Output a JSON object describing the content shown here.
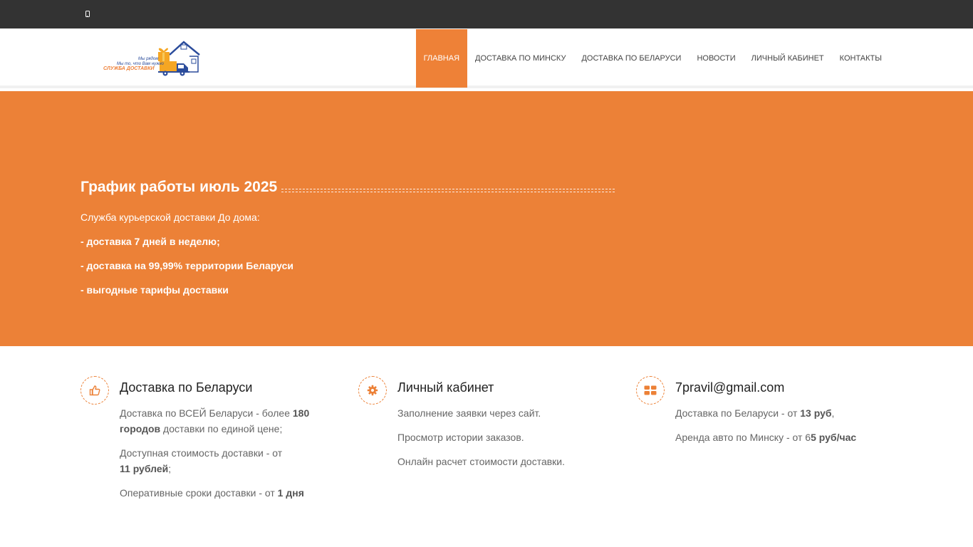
{
  "header": {
    "logo": {
      "tagline_1": "Мы рядом",
      "tagline_2": "Мы то, что Вам нужно",
      "name": "СЛУЖБА ДОСТАВКИ"
    },
    "nav": [
      {
        "label": "Главная",
        "active": true
      },
      {
        "label": "Доставка по Минску",
        "active": false
      },
      {
        "label": "Доставка по Беларуси",
        "active": false
      },
      {
        "label": "Новости",
        "active": false
      },
      {
        "label": "Личный кабинет",
        "active": false
      },
      {
        "label": "Контакты",
        "active": false
      }
    ]
  },
  "hero": {
    "title": "График работы июль 2025",
    "intro": "Служба курьерской доставки До дома:",
    "points": [
      "- доставка 7 дней в неделю;",
      "- доставка на 99,99% территории Беларуси",
      "- выгодные тарифы доставки"
    ]
  },
  "features": [
    {
      "icon": "thumbs-up-icon",
      "title": "Доставка по Беларуси",
      "paras": [
        {
          "pre": "Доставка по ВСЕЙ Беларуси - более ",
          "bold": "180 городов",
          "post": " доставки по единой цене;"
        },
        {
          "pre": "Доступная стоимость доставки - от ",
          "bold": "11 рублей",
          "post": ";"
        },
        {
          "pre": "Оперативные сроки доставки - от ",
          "bold": "1 дня",
          "post": ""
        }
      ]
    },
    {
      "icon": "gear-icon",
      "title": "Личный кабинет",
      "paras": [
        {
          "pre": "Заполнение заявки через сайт.",
          "bold": "",
          "post": ""
        },
        {
          "pre": "Просмотр истории заказов.",
          "bold": "",
          "post": ""
        },
        {
          "pre": "Онлайн расчет стоимости доставки.",
          "bold": "",
          "post": ""
        }
      ]
    },
    {
      "icon": "grid-icon",
      "title": "7pravil@gmail.com",
      "paras": [
        {
          "pre": "Доставка по Беларуси - от ",
          "bold": "13 руб",
          "post": ","
        },
        {
          "pre": "Аренда авто по Минску - от 6",
          "bold": "5 руб/час",
          "post": ""
        }
      ]
    }
  ],
  "colors": {
    "accent": "#ec8137",
    "topbar": "#333333",
    "logo_blue": "#2b4c9b"
  }
}
